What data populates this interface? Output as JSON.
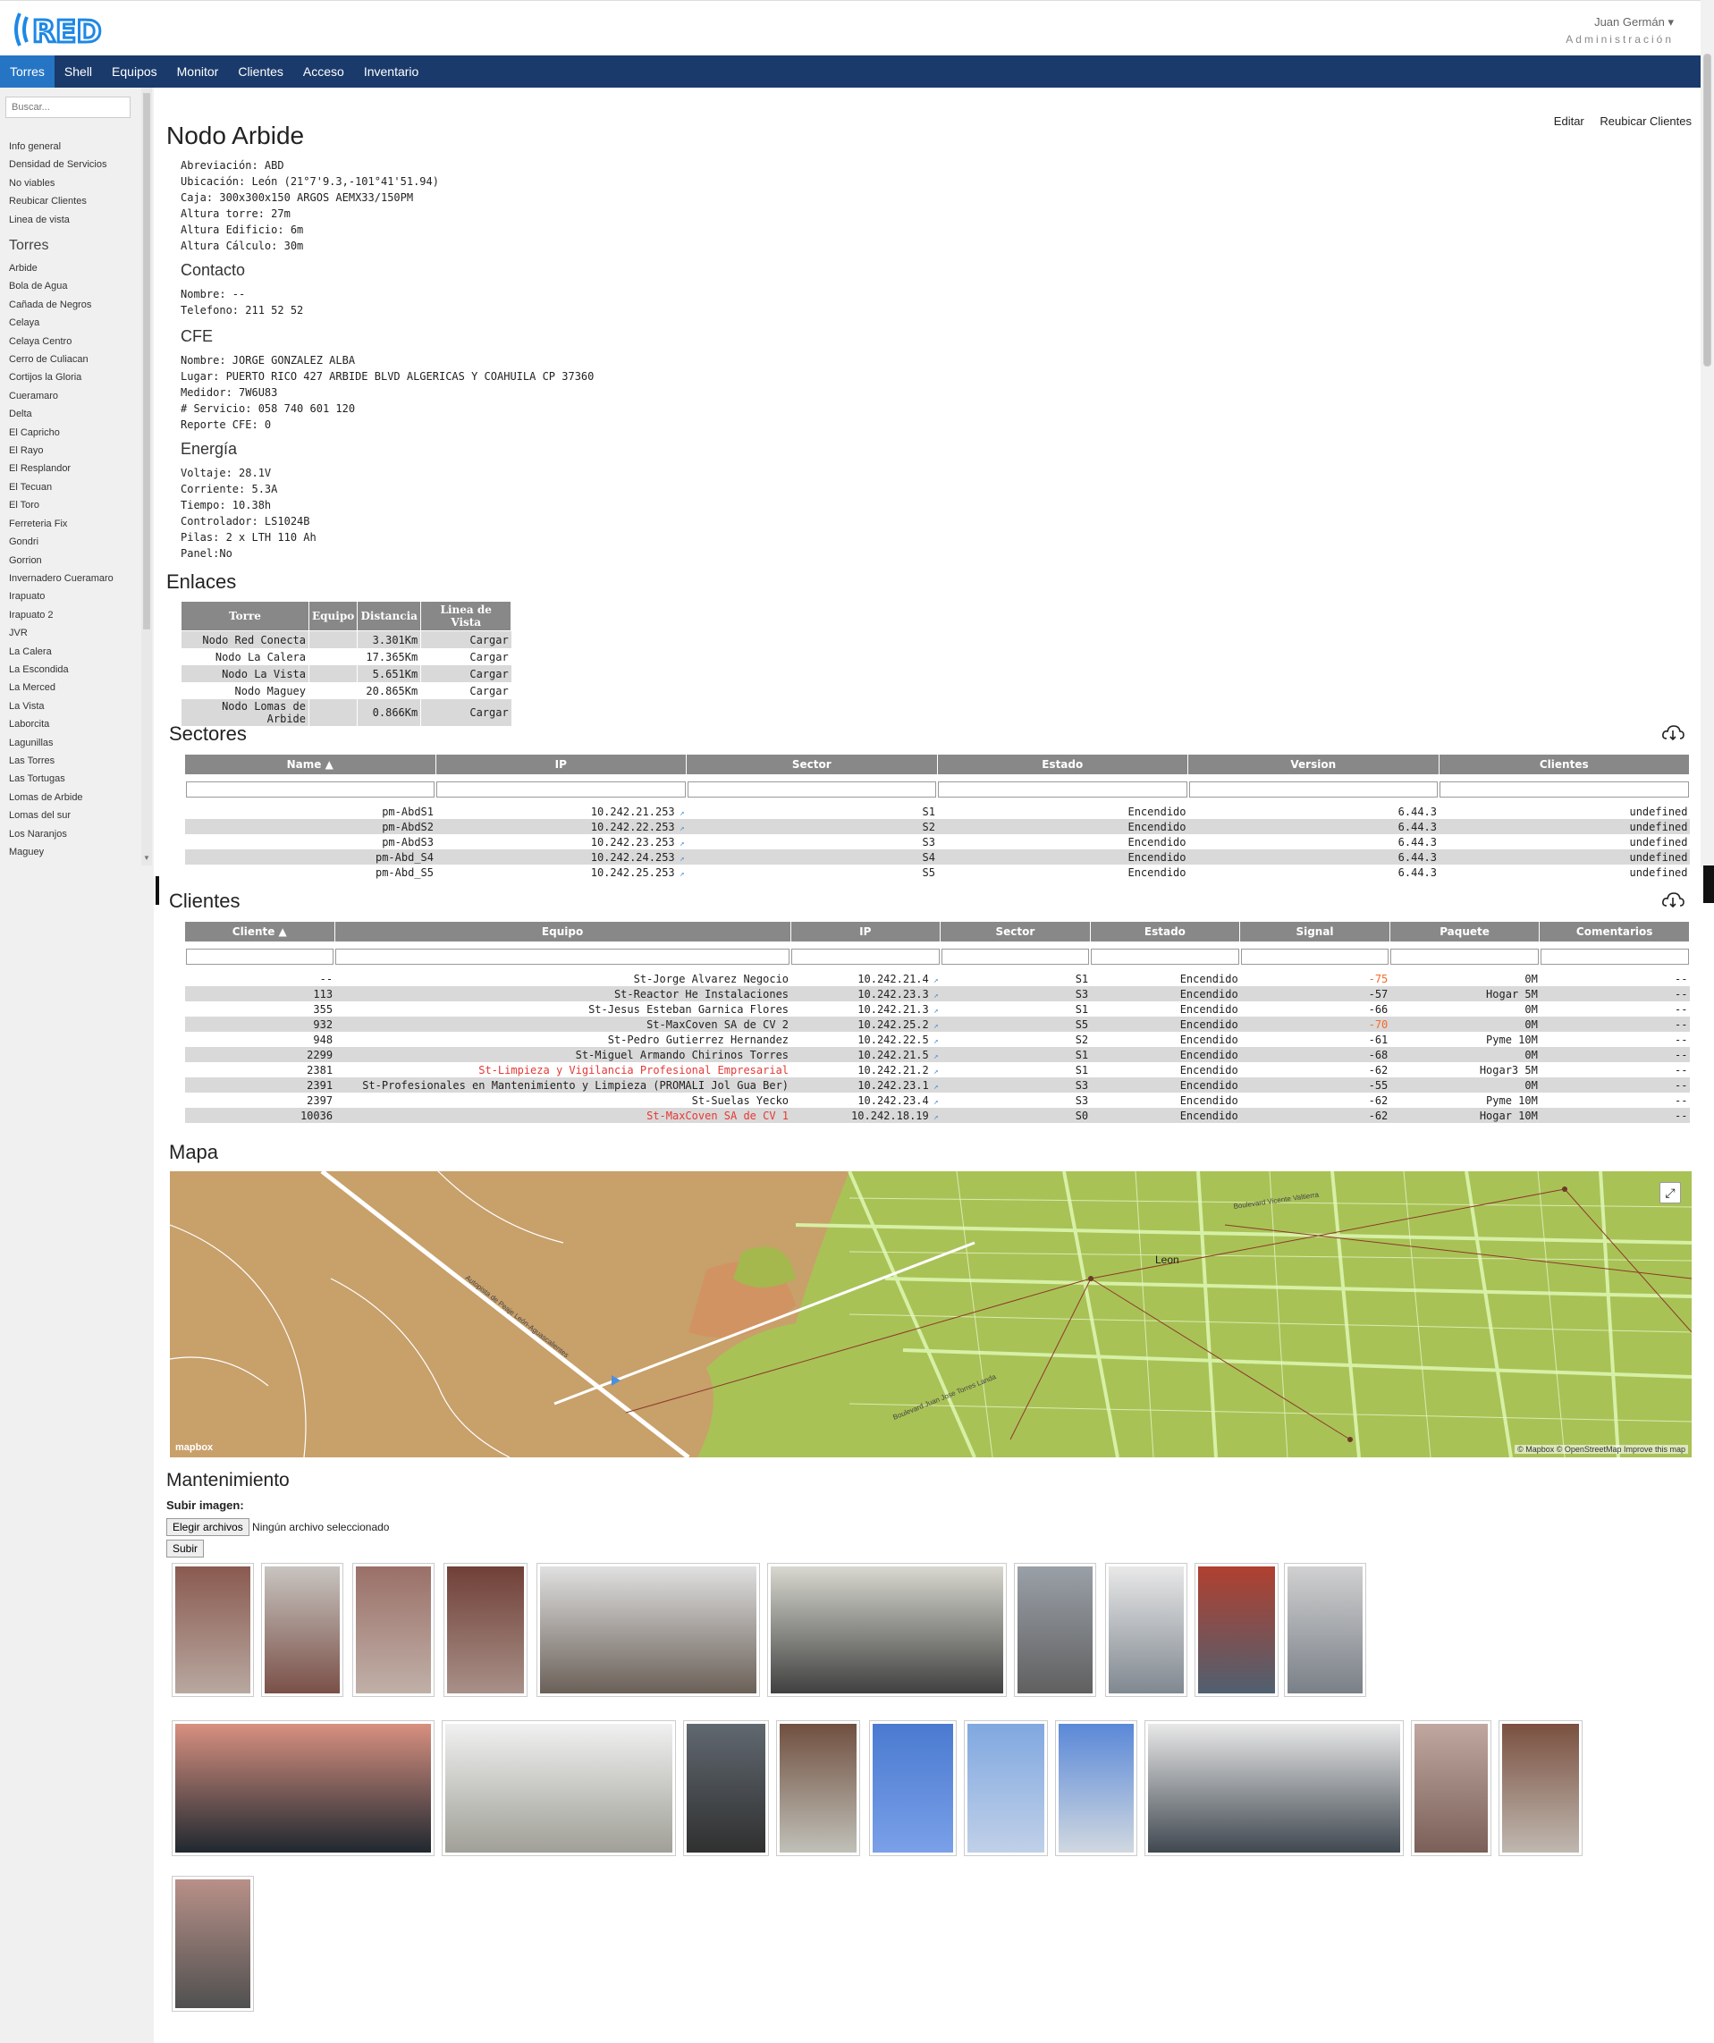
{
  "header": {
    "user_name": "Juan Germán",
    "user_role": "Administración",
    "logo_text": "RED"
  },
  "nav": [
    "Torres",
    "Shell",
    "Equipos",
    "Monitor",
    "Clientes",
    "Acceso",
    "Inventario"
  ],
  "sidebar": {
    "search_placeholder": "Buscar...",
    "links": [
      "Info general",
      "Densidad de Servicios",
      "No viables",
      "Reubicar Clientes",
      "Linea de vista"
    ],
    "towers_heading": "Torres",
    "towers": [
      "Arbide",
      "Bola de Agua",
      "Cañada de Negros",
      "Celaya",
      "Celaya Centro",
      "Cerro de Culiacan",
      "Cortijos la Gloria",
      "Cueramaro",
      "Delta",
      "El Capricho",
      "El Rayo",
      "El Resplandor",
      "El Tecuan",
      "El Toro",
      "Ferreteria Fix",
      "Gondri",
      "Gorrion",
      "Invernadero Cueramaro",
      "Irapuato",
      "Irapuato 2",
      "JVR",
      "La Calera",
      "La Escondida",
      "La Merced",
      "La Vista",
      "Laborcita",
      "Lagunillas",
      "Las Torres",
      "Las Tortugas",
      "Lomas de Arbide",
      "Lomas del sur",
      "Los Naranjos",
      "Maguey"
    ]
  },
  "page": {
    "title": "Nodo Arbide",
    "edit_label": "Editar",
    "relocate_label": "Reubicar Clientes",
    "general": [
      "Abreviación: ABD",
      "Ubicación: León (21°7'9.3,-101°41'51.94)",
      "Caja: 300x300x150 ARGOS AEMX33/150PM",
      "Altura torre: 27m",
      "Altura Edificio: 6m",
      "Altura Cálculo: 30m"
    ],
    "contact_heading": "Contacto",
    "contact": [
      "Nombre: --",
      "Telefono: 211 52 52"
    ],
    "cfe_heading": "CFE",
    "cfe": [
      "Nombre: JORGE GONZALEZ ALBA",
      "Lugar: PUERTO RICO 427 ARBIDE BLVD ALGERICAS Y COAHUILA CP 37360",
      "Medidor: 7W6U83",
      "# Servicio: 058 740 601 120",
      "Reporte CFE: 0"
    ],
    "energy_heading": "Energía",
    "energy": [
      "Voltaje: 28.1V",
      "Corriente: 5.3A",
      "Tiempo: 10.38h",
      "Controlador: LS1024B",
      "Pilas: 2 x LTH 110 Ah",
      "Panel:No"
    ]
  },
  "links_section": {
    "heading": "Enlaces",
    "columns": [
      "Torre",
      "Equipo",
      "Distancia",
      "Linea de Vista"
    ],
    "rows": [
      [
        "Nodo Red Conecta",
        "",
        "3.301Km",
        "Cargar"
      ],
      [
        "Nodo La Calera",
        "",
        "17.365Km",
        "Cargar"
      ],
      [
        "Nodo La Vista",
        "",
        "5.651Km",
        "Cargar"
      ],
      [
        "Nodo Maguey",
        "",
        "20.865Km",
        "Cargar"
      ],
      [
        "Nodo Lomas de Arbide",
        "",
        "0.866Km",
        "Cargar"
      ]
    ]
  },
  "sectors": {
    "heading": "Sectores",
    "columns": [
      "Name ▲",
      "IP",
      "Sector",
      "Estado",
      "Version",
      "Clientes"
    ],
    "rows": [
      [
        "pm-AbdS1",
        "10.242.21.253",
        "S1",
        "Encendido",
        "6.44.3",
        "undefined"
      ],
      [
        "pm-AbdS2",
        "10.242.22.253",
        "S2",
        "Encendido",
        "6.44.3",
        "undefined"
      ],
      [
        "pm-AbdS3",
        "10.242.23.253",
        "S3",
        "Encendido",
        "6.44.3",
        "undefined"
      ],
      [
        "pm-Abd_S4",
        "10.242.24.253",
        "S4",
        "Encendido",
        "6.44.3",
        "undefined"
      ],
      [
        "pm-Abd_S5",
        "10.242.25.253",
        "S5",
        "Encendido",
        "6.44.3",
        "undefined"
      ]
    ]
  },
  "clients": {
    "heading": "Clientes",
    "columns": [
      "Cliente ▲",
      "Equipo",
      "IP",
      "Sector",
      "Estado",
      "Signal",
      "Paquete",
      "Comentarios"
    ],
    "rows": [
      [
        "--",
        "St-Jorge Alvarez Negocio",
        "10.242.21.4",
        "S1",
        "Encendido",
        "-75",
        "0M",
        "--"
      ],
      [
        "113",
        "St-Reactor He Instalaciones",
        "10.242.23.3",
        "S3",
        "Encendido",
        "-57",
        "Hogar 5M",
        "--"
      ],
      [
        "355",
        "St-Jesus Esteban Garnica Flores",
        "10.242.21.3",
        "S1",
        "Encendido",
        "-66",
        "0M",
        "--"
      ],
      [
        "932",
        "St-MaxCoven SA de CV 2",
        "10.242.25.2",
        "S5",
        "Encendido",
        "-70",
        "0M",
        "--"
      ],
      [
        "948",
        "St-Pedro Gutierrez Hernandez",
        "10.242.22.5",
        "S2",
        "Encendido",
        "-61",
        "Pyme 10M",
        "--"
      ],
      [
        "2299",
        "St-Miguel Armando Chirinos Torres",
        "10.242.21.5",
        "S1",
        "Encendido",
        "-68",
        "0M",
        "--"
      ],
      [
        "2381",
        "St-Limpieza y Vigilancia Profesional Empresarial",
        "10.242.21.2",
        "S1",
        "Encendido",
        "-62",
        "Hogar3 5M",
        "--"
      ],
      [
        "2391",
        "St-Profesionales en Mantenimiento y Limpieza (PROMALI Jol Gua Ber)",
        "10.242.23.1",
        "S3",
        "Encendido",
        "-55",
        "0M",
        "--"
      ],
      [
        "2397",
        "St-Suelas Yecko",
        "10.242.23.4",
        "S3",
        "Encendido",
        "-62",
        "Pyme 10M",
        "--"
      ],
      [
        "10036",
        "St-MaxCoven SA de CV 1",
        "10.242.18.19",
        "S0",
        "Encendido",
        "-62",
        "Hogar 10M",
        "--"
      ]
    ],
    "red_equipo_rows": [
      6,
      9
    ],
    "orange_signal_rows": [
      0,
      3
    ]
  },
  "map": {
    "heading": "Mapa",
    "city_label": "Leon",
    "road_label": "Autopista de Peaje León-Aguascalientes",
    "road_label_2": "Boulevard Juan Jose Torres Landa",
    "road_label_3": "Boulevard Vicente Valtierra",
    "logo": "mapbox",
    "attribution": [
      "© Mapbox",
      "© OpenStreetMap",
      "Improve this map"
    ],
    "colors": {
      "rural": "#c8a06a",
      "urban": "#a9c256",
      "roads": "#d6f0a6"
    }
  },
  "maintenance": {
    "heading": "Mantenimiento",
    "upload_label": "Subir imagen:",
    "choose_button": "Elegir archivos",
    "no_file": "Ningún archivo seleccionado",
    "submit_button": "Subir",
    "photos": [
      "photo-rooftop",
      "photo-rooftop-box",
      "photo-rooftop-2",
      "photo-rooftop-3",
      "photo-open-cabinet",
      "photo-batteries",
      "photo-building",
      "photo-antenna",
      "photo-antenna-2",
      "photo-antenna-3",
      "photo-controller-mt50",
      "photo-wall-box",
      "photo-controller-2",
      "photo-meter",
      "photo-sky-tower",
      "photo-tower",
      "photo-tower-2",
      "photo-controller-3",
      "photo-block",
      "photo-block-2",
      "photo-cable"
    ]
  }
}
